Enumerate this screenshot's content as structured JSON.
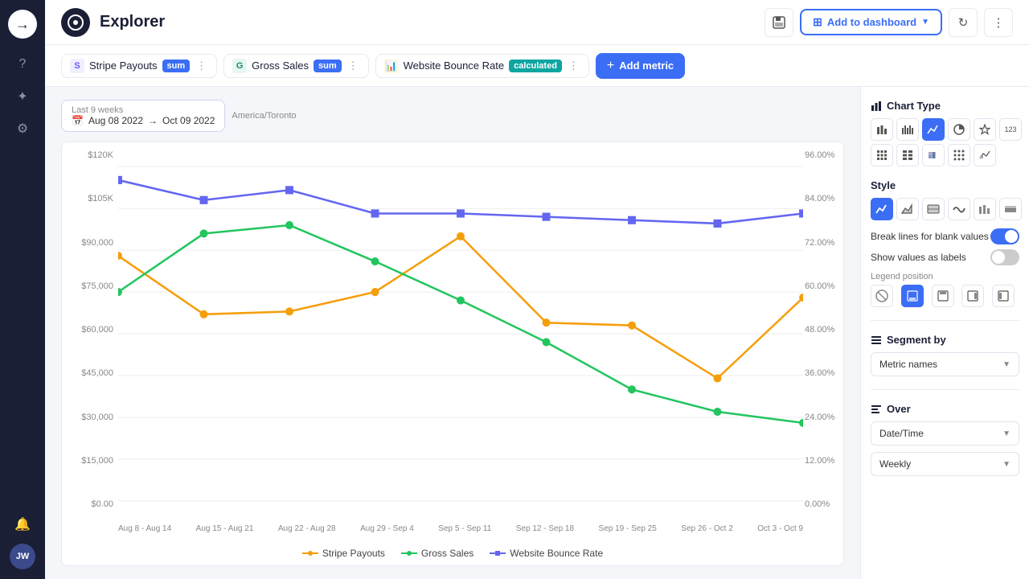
{
  "app": {
    "title": "Explorer",
    "logo_symbol": "◎"
  },
  "topbar": {
    "save_icon": "💾",
    "add_dashboard_label": "Add to dashboard",
    "refresh_icon": "↻",
    "more_icon": "⋮"
  },
  "metrics": [
    {
      "id": "stripe",
      "icon": "S",
      "icon_color": "#635bff",
      "name": "Stripe Payouts",
      "badge": "sum",
      "badge_type": "blue"
    },
    {
      "id": "gross",
      "icon": "G",
      "icon_color": "#1a8a6e",
      "name": "Gross Sales",
      "badge": "sum",
      "badge_type": "blue"
    },
    {
      "id": "bounce",
      "icon": "📊",
      "icon_color": "#f59e0b",
      "name": "Website Bounce Rate",
      "badge": "calculated",
      "badge_type": "teal"
    }
  ],
  "add_metric_label": "+ Add metric",
  "date_range": {
    "label": "Last 9 weeks",
    "timezone": "America/Toronto",
    "start": "Aug 08 2022",
    "end": "Oct 09 2022"
  },
  "chart": {
    "y_left_labels": [
      "$120K",
      "$105K",
      "$90,000",
      "$75,000",
      "$60,000",
      "$45,000",
      "$30,000",
      "$15,000",
      "$0.00"
    ],
    "y_right_labels": [
      "96.00%",
      "84.00%",
      "72.00%",
      "60.00%",
      "48.00%",
      "36.00%",
      "24.00%",
      "12.00%",
      "0.00%"
    ],
    "x_labels": [
      "Aug 8 - Aug 14",
      "Aug 15 - Aug 21",
      "Aug 22 - Aug 28",
      "Aug 29 - Sep 4",
      "Sep 5 - Sep 11",
      "Sep 12 - Sep 18",
      "Sep 19 - Sep 25",
      "Sep 26 - Oct 2",
      "Oct 3 - Oct 9"
    ],
    "series": [
      {
        "name": "Stripe Payouts",
        "color": "#f59e0b",
        "data": [
          88,
          67,
          68,
          75,
          95,
          64,
          63,
          44,
          73
        ]
      },
      {
        "name": "Gross Sales",
        "color": "#22c55e",
        "data": [
          75,
          96,
          99,
          86,
          72,
          57,
          40,
          32,
          28
        ]
      },
      {
        "name": "Website Bounce Rate",
        "color": "#6366f1",
        "data": [
          96,
          90,
          93,
          86,
          86,
          85,
          84,
          83,
          86
        ]
      }
    ]
  },
  "right_panel": {
    "chart_type_title": "Chart Type",
    "style_title": "Style",
    "segment_title": "Segment by",
    "over_title": "Over",
    "break_lines_label": "Break lines for blank values",
    "show_values_label": "Show values as labels",
    "legend_position_label": "Legend position",
    "segment_placeholder": "Metric names",
    "over_placeholder": "Date/Time",
    "frequency_placeholder": "Weekly",
    "chart_types": [
      {
        "id": "bar",
        "symbol": "▦",
        "active": false
      },
      {
        "id": "grouped-bar",
        "symbol": "▦",
        "active": false
      },
      {
        "id": "line",
        "symbol": "📈",
        "active": true
      },
      {
        "id": "pie",
        "symbol": "◕",
        "active": false
      },
      {
        "id": "star",
        "symbol": "✦",
        "active": false
      },
      {
        "id": "num",
        "symbol": "123",
        "active": false
      },
      {
        "id": "table",
        "symbol": "▤",
        "active": false
      },
      {
        "id": "pivot",
        "symbol": "▤",
        "active": false
      },
      {
        "id": "stacked-bar",
        "symbol": "▦",
        "active": false
      },
      {
        "id": "dot",
        "symbol": "∷",
        "active": false
      },
      {
        "id": "waterfall",
        "symbol": "╱╲",
        "active": false
      }
    ],
    "style_types": [
      {
        "id": "line",
        "symbol": "📉",
        "active": true
      },
      {
        "id": "area",
        "symbol": "🏔",
        "active": false
      },
      {
        "id": "photo",
        "symbol": "🖼",
        "active": false
      },
      {
        "id": "wave",
        "symbol": "〜",
        "active": false
      },
      {
        "id": "bars2",
        "symbol": "📊",
        "active": false
      },
      {
        "id": "stacked",
        "symbol": "▧",
        "active": false
      }
    ],
    "break_lines_on": true,
    "show_values_on": false,
    "legend_positions": [
      {
        "id": "none",
        "symbol": "⊘",
        "active": false
      },
      {
        "id": "bottom",
        "symbol": "▭",
        "active": true
      },
      {
        "id": "top",
        "symbol": "▭",
        "active": false
      },
      {
        "id": "right",
        "symbol": "▯",
        "active": false
      },
      {
        "id": "left",
        "symbol": "▯",
        "active": false
      }
    ]
  }
}
